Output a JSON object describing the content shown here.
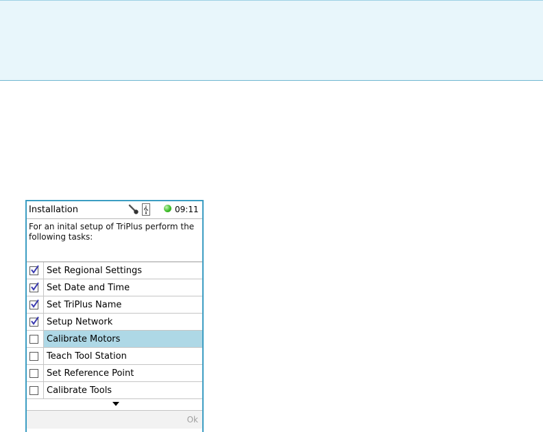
{
  "window": {
    "title": "Installation",
    "time": "09:11",
    "status_icons": [
      "wrench-icon",
      "usb-icon",
      "status-dot"
    ],
    "status_color": "#3fbf2a"
  },
  "instructions": "For an inital setup of TriPlus perform the following tasks:",
  "tasks": [
    {
      "label": "Set Regional Settings",
      "checked": true
    },
    {
      "label": "Set Date and Time",
      "checked": true
    },
    {
      "label": "Set TriPlus Name",
      "checked": true
    },
    {
      "label": "Setup Network",
      "checked": true
    },
    {
      "label": "Calibrate Motors",
      "checked": false,
      "selected": true
    },
    {
      "label": "Teach Tool Station",
      "checked": false
    },
    {
      "label": "Set Reference Point",
      "checked": false
    },
    {
      "label": "Calibrate Tools",
      "checked": false
    }
  ],
  "softkeys": {
    "ok_label": "Ok"
  },
  "colors": {
    "selection": "#aed8e6",
    "frame": "#3a9cc2",
    "banner": "#e8f6fb"
  }
}
